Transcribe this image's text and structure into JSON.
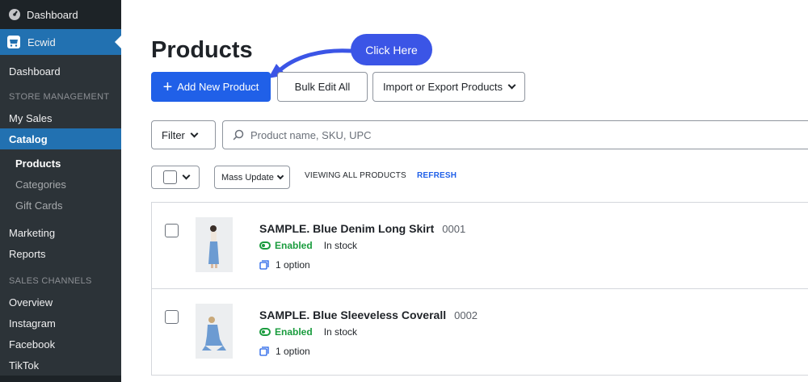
{
  "sidebar": {
    "dashboard_top": "Dashboard",
    "ecwid": "Ecwid",
    "dashboard": "Dashboard",
    "section_store": "STORE MANAGEMENT",
    "my_sales": "My Sales",
    "catalog": "Catalog",
    "catalog_items": [
      "Products",
      "Categories",
      "Gift Cards"
    ],
    "marketing": "Marketing",
    "reports": "Reports",
    "section_channels": "SALES CHANNELS",
    "overview": "Overview",
    "instagram": "Instagram",
    "facebook": "Facebook",
    "tiktok": "TikTok"
  },
  "main": {
    "title": "Products",
    "add_button": "Add New Product",
    "bulk_button": "Bulk Edit All",
    "import_button": "Import or Export Products",
    "callout": "Click Here",
    "filter_label": "Filter",
    "search_placeholder": "Product name, SKU, UPC",
    "mass_update": "Mass Update",
    "viewing": "VIEWING ALL PRODUCTS",
    "refresh": "REFRESH"
  },
  "products": [
    {
      "name": "SAMPLE. Blue Denim Long Skirt",
      "sku": "0001",
      "status": "Enabled",
      "stock": "In stock",
      "options": "1 option"
    },
    {
      "name": "SAMPLE. Blue Sleeveless Coverall",
      "sku": "0002",
      "status": "Enabled",
      "stock": "In stock",
      "options": "1 option"
    }
  ],
  "colors": {
    "primary": "#2060e8",
    "callout": "#3b55e6",
    "enabled": "#1a9c3e",
    "sidebar": "#1d2327",
    "sidebar_active": "#2271b1"
  }
}
